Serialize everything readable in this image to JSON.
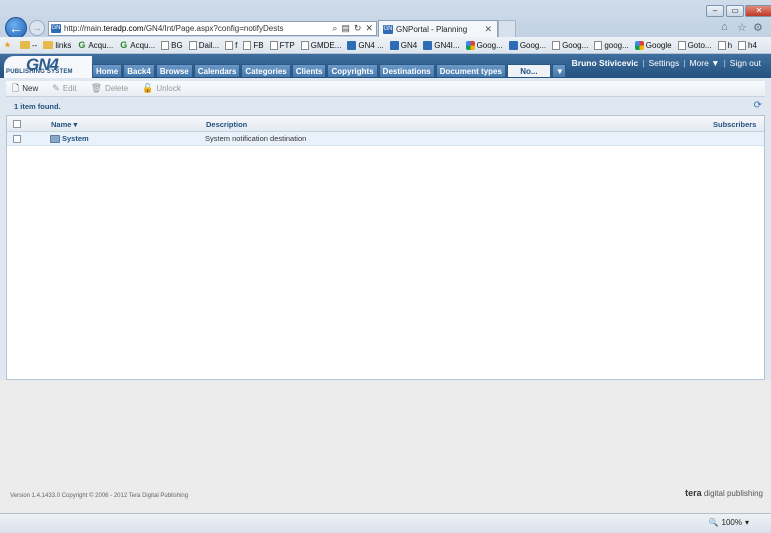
{
  "browser": {
    "address": {
      "prefix": "http://main.",
      "domain": "teradp.com",
      "path": "/GN4/Int/Page.aspx?config=notifyDests"
    },
    "tab_title": "GNPortal - Planning",
    "favorites": [
      {
        "label": "",
        "icon": "favorites-star-icon"
      },
      {
        "label": "--",
        "icon": "folder-icon"
      },
      {
        "label": "links",
        "icon": "folder-icon"
      },
      {
        "label": "Acqu...",
        "icon": "g-icon"
      },
      {
        "label": "Acqu...",
        "icon": "g-icon"
      },
      {
        "label": "BG",
        "icon": "page-icon"
      },
      {
        "label": "Dail...",
        "icon": "page-icon"
      },
      {
        "label": "f",
        "icon": "page-icon"
      },
      {
        "label": "FB",
        "icon": "page-icon"
      },
      {
        "label": "FTP",
        "icon": "page-icon"
      },
      {
        "label": "GMDE...",
        "icon": "page-icon"
      },
      {
        "label": "GN4 ...",
        "icon": "gn-icon"
      },
      {
        "label": "GN4",
        "icon": "gn-icon"
      },
      {
        "label": "GN4I...",
        "icon": "gn-icon"
      },
      {
        "label": "Goog...",
        "icon": "google-icon"
      },
      {
        "label": "Goog...",
        "icon": "gn-icon"
      },
      {
        "label": "Goog...",
        "icon": "page-icon"
      },
      {
        "label": "goog...",
        "icon": "page-icon"
      },
      {
        "label": "Google",
        "icon": "google-icon"
      },
      {
        "label": "Goto...",
        "icon": "page-icon"
      },
      {
        "label": "h",
        "icon": "page-icon"
      },
      {
        "label": "h4",
        "icon": "page-icon"
      }
    ],
    "zoom": "100%"
  },
  "app": {
    "logo_text": "GN4",
    "logo_subtext": "PUBLISHING SYSTEM",
    "nav": [
      "Home",
      "Back4",
      "Browse",
      "Calendars",
      "Categories",
      "Clients",
      "Copyrights",
      "Destinations",
      "Document types",
      "No..."
    ],
    "nav_more": "▼",
    "user": "Bruno Stivicevic",
    "settings": "Settings",
    "more": "More ▼",
    "signout": "Sign out"
  },
  "toolbar": {
    "new": "New",
    "edit": "Edit",
    "delete": "Delete",
    "unlock": "Unlock"
  },
  "status": "1 item found.",
  "table": {
    "headers": {
      "name": "Name ▾",
      "description": "Description",
      "subscribers": "Subscribers"
    },
    "rows": [
      {
        "name": "System",
        "description": "System notification destination",
        "subscribers": ""
      }
    ]
  },
  "footer": {
    "version": "Version 1.4.1433.0 Copyright © 2006 - 2012 Tera Digital Publishing",
    "brand": "tera",
    "brand_sub": "digital publishing"
  }
}
